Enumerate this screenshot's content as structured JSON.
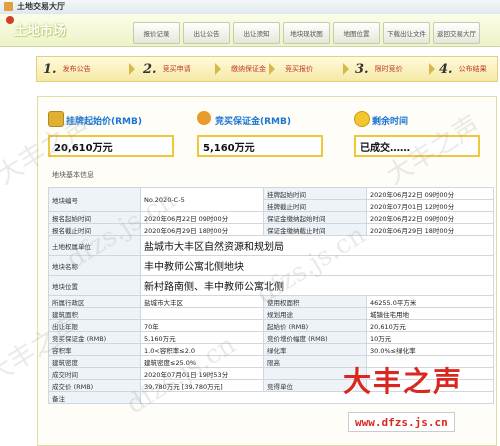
{
  "window": {
    "title": "土地交易大厅"
  },
  "header": {
    "logo_text": "土地市场"
  },
  "nav": {
    "tabs": [
      "报价记录",
      "出让公告",
      "出让须知",
      "地块现状图",
      "地图位置",
      "下载出让文件",
      "返回交易大厅"
    ]
  },
  "steps": [
    {
      "num": "1.",
      "label": "发布公告"
    },
    {
      "num": "2.",
      "label": "竞买申请"
    },
    {
      "num": "",
      "label": "缴纳保证金"
    },
    {
      "num": "",
      "label": "竞买报价"
    },
    {
      "num": "3.",
      "label": "限时竞价"
    },
    {
      "num": "4.",
      "label": "公布结果"
    }
  ],
  "info_boxes": [
    {
      "label": "挂牌起始价(RMB)",
      "value": "20,610万元",
      "icon": "coin-stack-icon"
    },
    {
      "label": "竞买保证金(RMB)",
      "value": "5,160万元",
      "icon": "money-bag-icon"
    },
    {
      "label": "剩余时间",
      "value": "已成交……",
      "icon": "stopwatch-icon"
    }
  ],
  "section_title": "地块基本信息",
  "table": {
    "rows": [
      [
        "地块编号",
        "No.2020-C-5",
        "挂牌起始时间",
        "2020年06月22日 09时00分"
      ],
      [
        "",
        "",
        "挂牌截止时间",
        "2020年07月01日 12时00分"
      ],
      [
        "报名起始时间",
        "2020年06月22日 09时00分",
        "保证金缴纳起始时间",
        "2020年06月22日 09时00分"
      ],
      [
        "报名截止时间",
        "2020年06月29日 18时00分",
        "保证金缴纳截止时间",
        "2020年06月29日 18时00分"
      ],
      [
        "土地权属单位",
        "盐城市大丰区自然资源和规划局"
      ],
      [
        "地块名称",
        "丰中教师公寓北侧地块"
      ],
      [
        "地块位置",
        "新村路南侧、丰中教师公寓北侧"
      ],
      [
        "所属行政区",
        "盐城市大丰区",
        "使用权面积",
        "46255.0平方米"
      ],
      [
        "建筑面积",
        "",
        "规划用途",
        "城镇住宅用地"
      ],
      [
        "出让年限",
        "70年",
        "起始价 (RMB)",
        "20,610万元"
      ],
      [
        "竞买保证金 (RMB)",
        "5,160万元",
        "竞价增价幅度 (RMB)",
        "10万元"
      ],
      [
        "容积率",
        "1.0<容积率≤2.0",
        "绿化率",
        "30.0%≤绿化率"
      ],
      [
        "建筑密度",
        "建筑密度≤25.0%",
        "限高",
        ""
      ],
      [
        "成交时间",
        "2020年07月01日 19时53分",
        "",
        ""
      ],
      [
        "成交价 (RMB)",
        "39,780万元 [39,780万元]",
        "竞得单位",
        ""
      ],
      [
        "备注",
        ""
      ]
    ]
  },
  "watermarks": [
    "大丰之声",
    "dfzs.js.cn",
    "大丰之声",
    "dfzs.js.cn",
    "大丰之声",
    "dfzs.js.cn"
  ],
  "brand": {
    "name": "大丰之声",
    "url": "www.dfzs.js.cn"
  }
}
